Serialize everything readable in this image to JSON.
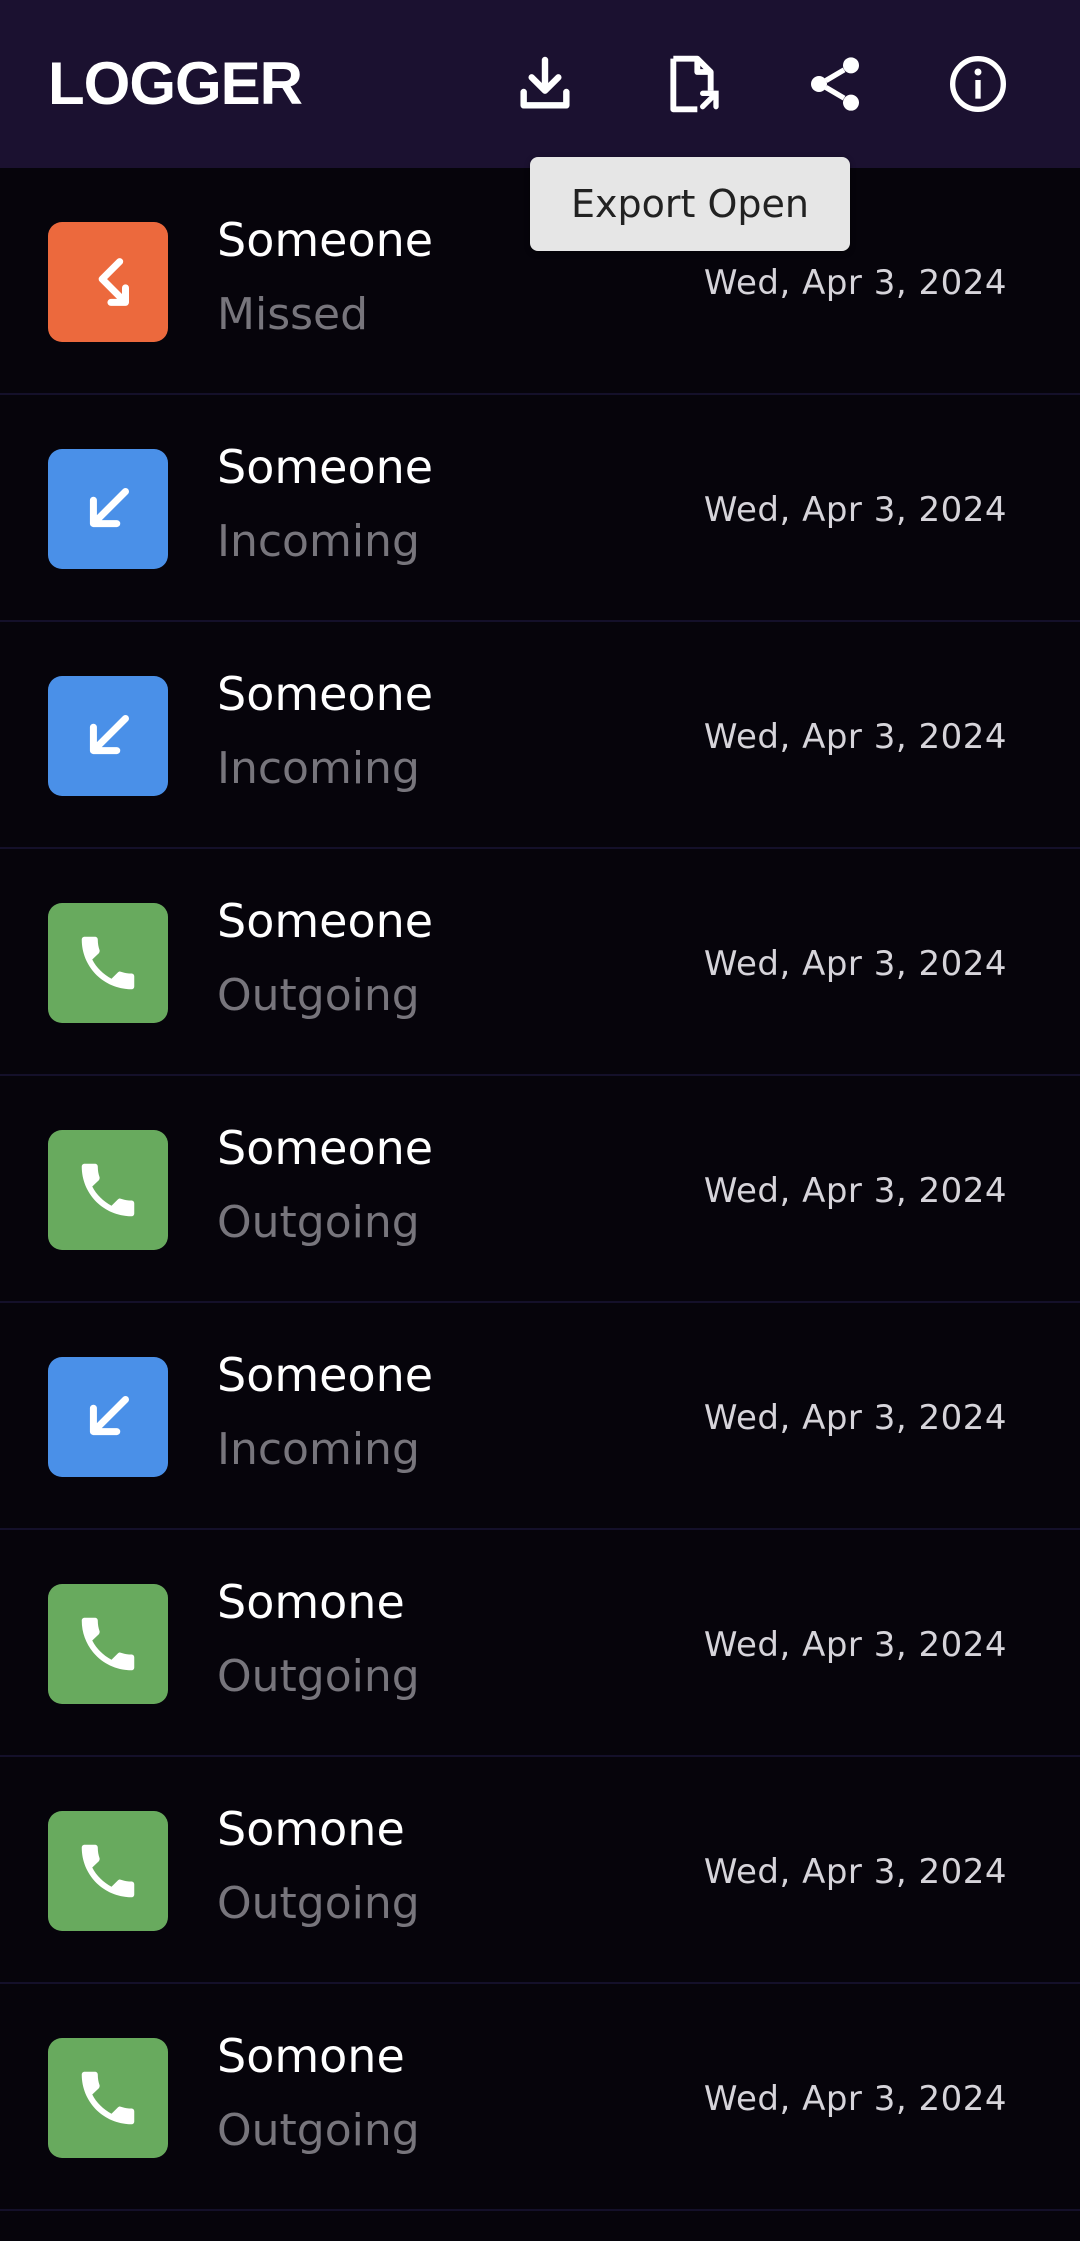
{
  "app": {
    "title": "LOGGER"
  },
  "toolbar": {
    "actions": [
      {
        "icon": "download-icon",
        "name": "download"
      },
      {
        "icon": "file-open-icon",
        "name": "export-open"
      },
      {
        "icon": "share-icon",
        "name": "share"
      },
      {
        "icon": "info-icon",
        "name": "info"
      }
    ],
    "tooltip": "Export Open"
  },
  "colors": {
    "topbar": "#1b1130",
    "background": "#06040b",
    "missed": "#ec693d",
    "incoming": "#4a90e8",
    "outgoing": "#68aa5e",
    "secondary_text": "#77757c"
  },
  "calls": [
    {
      "name": "Someone",
      "type": "Missed",
      "date": "Wed, Apr 3, 2024",
      "icon": "missed-call-icon"
    },
    {
      "name": "Someone",
      "type": "Incoming",
      "date": "Wed, Apr 3, 2024",
      "icon": "incoming-call-icon"
    },
    {
      "name": "Someone",
      "type": "Incoming",
      "date": "Wed, Apr 3, 2024",
      "icon": "incoming-call-icon"
    },
    {
      "name": "Someone",
      "type": "Outgoing",
      "date": "Wed, Apr 3, 2024",
      "icon": "phone-icon"
    },
    {
      "name": "Someone",
      "type": "Outgoing",
      "date": "Wed, Apr 3, 2024",
      "icon": "phone-icon"
    },
    {
      "name": "Someone",
      "type": "Incoming",
      "date": "Wed, Apr 3, 2024",
      "icon": "incoming-call-icon"
    },
    {
      "name": "Somone",
      "type": "Outgoing",
      "date": "Wed, Apr 3, 2024",
      "icon": "phone-icon"
    },
    {
      "name": "Somone",
      "type": "Outgoing",
      "date": "Wed, Apr 3, 2024",
      "icon": "phone-icon"
    },
    {
      "name": "Somone",
      "type": "Outgoing",
      "date": "Wed, Apr 3, 2024",
      "icon": "phone-icon"
    }
  ]
}
